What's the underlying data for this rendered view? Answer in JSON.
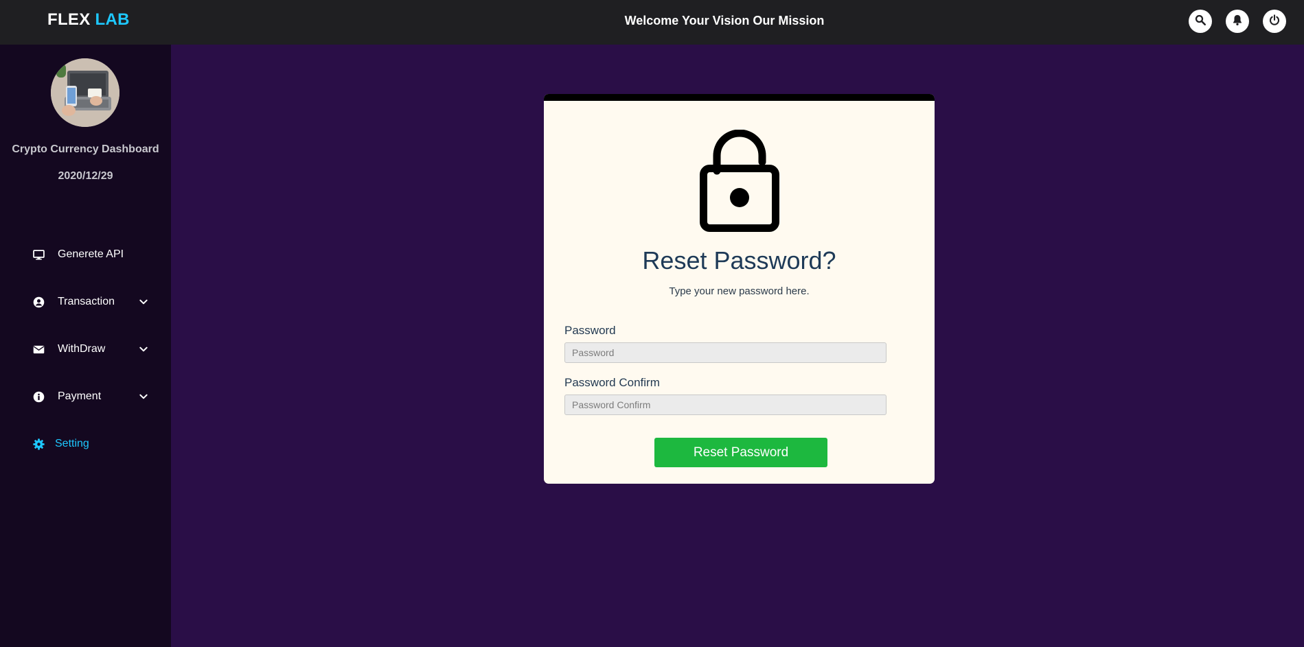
{
  "header": {
    "logo_main": "FLEX",
    "logo_accent": "LAB",
    "welcome": "Welcome Your Vision Our Mission",
    "buttons": [
      {
        "icon": "search-icon"
      },
      {
        "icon": "bell-icon"
      },
      {
        "icon": "power-icon"
      }
    ]
  },
  "sidebar": {
    "title": "Crypto Currency Dashboard",
    "date": "2020/12/29",
    "items": [
      {
        "label": "Generete API",
        "icon": "desktop-icon",
        "expandable": false
      },
      {
        "label": "Transaction",
        "icon": "user-circle-icon",
        "expandable": true
      },
      {
        "label": "WithDraw",
        "icon": "envelope-icon",
        "expandable": true
      },
      {
        "label": "Payment",
        "icon": "info-icon",
        "expandable": true
      },
      {
        "label": "Setting",
        "icon": "gear-icon",
        "expandable": false,
        "active": true
      }
    ]
  },
  "card": {
    "title": "Reset Password?",
    "subtitle": "Type your new password here.",
    "password_label": "Password",
    "password_placeholder": "Password",
    "confirm_label": "Password Confirm",
    "confirm_placeholder": "Password Confirm",
    "submit_label": "Reset Password"
  },
  "colors": {
    "accent": "#1ec8ff",
    "background": "#2a0e47",
    "sidebar": "#140820",
    "topbar": "#1f1f22",
    "button": "#1db83f"
  }
}
